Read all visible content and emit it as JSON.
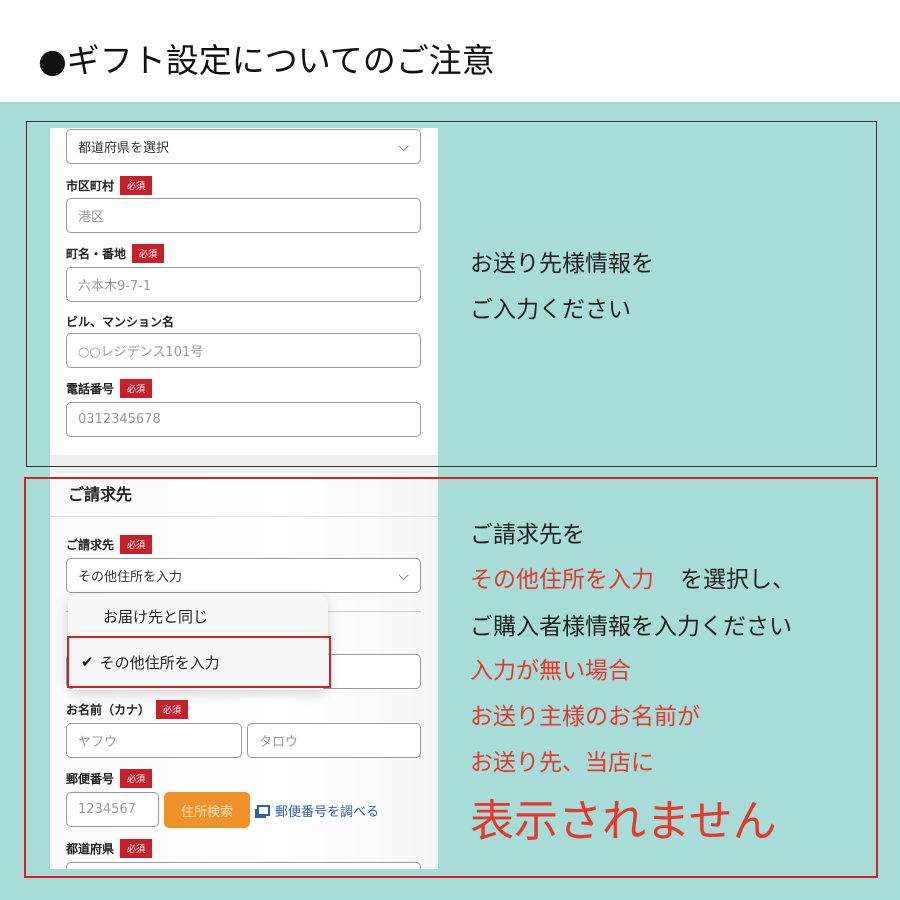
{
  "title": "●ギフト設定についてのご注意",
  "required_badge": "必須",
  "shipping_form": {
    "prefecture_select": "都道府県を選択",
    "city_label": "市区町村",
    "city_placeholder": "港区",
    "street_label": "町名・番地",
    "street_placeholder": "六本木9-7-1",
    "building_label": "ビル、マンション名",
    "building_placeholder": "○○レジデンス101号",
    "phone_label": "電話番号",
    "phone_placeholder": "0312345678"
  },
  "shipping_note": [
    "お送り先様情報を",
    "ご入力ください"
  ],
  "billing_form": {
    "heading": "ご請求先",
    "billing_label": "ご請求先",
    "billing_select": "その他住所を入力",
    "dropdown_options": [
      "お届け先と同じ",
      "その他住所を入力"
    ],
    "selected_option": "その他住所を入力",
    "kana_label": "お名前（カナ）",
    "kana_last_placeholder": "ヤフウ",
    "kana_first_placeholder": "タロウ",
    "postal_label": "郵便番号",
    "postal_placeholder": "1234567",
    "address_search_button": "住所検索",
    "postal_lookup_link": "郵便番号を調べる",
    "prefecture_label": "都道府県"
  },
  "billing_note": {
    "line1": "ご請求先を",
    "line2_highlight": "その他住所を入力",
    "line2_rest": "を選択し、",
    "line3": "ご購入者様情報を入力ください",
    "line4": "入力が無い場合",
    "line5": "お送り主様のお名前が",
    "line6": "お送り先、当店に",
    "line7": "表示されません"
  },
  "colors": {
    "background": "#a8dcd8",
    "accent_red": "#e33a2a",
    "badge_red": "#c8202a",
    "button_orange": "#f0922a",
    "link_blue": "#2b5fb4"
  }
}
